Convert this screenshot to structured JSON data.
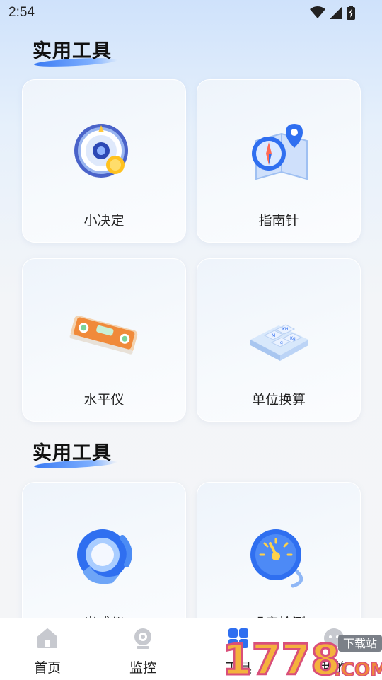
{
  "status_bar": {
    "time": "2:54"
  },
  "sections": [
    {
      "title": "实用工具"
    },
    {
      "title": "实用工具"
    }
  ],
  "tools": [
    {
      "label": "小决定",
      "icon": "decision-wheel-icon"
    },
    {
      "label": "指南针",
      "icon": "compass-map-icon"
    },
    {
      "label": "水平仪",
      "icon": "spirit-level-icon"
    },
    {
      "label": "单位换算",
      "icon": "unit-keys-icon"
    },
    {
      "label": "光感仪",
      "icon": "light-meter-icon"
    },
    {
      "label": "噪音检测",
      "icon": "noise-gauge-icon"
    }
  ],
  "nav": {
    "items": [
      {
        "label": "首页",
        "icon": "home-icon"
      },
      {
        "label": "监控",
        "icon": "camera-icon"
      },
      {
        "label": "工具",
        "icon": "tools-grid-icon",
        "active": true
      },
      {
        "label": "我的",
        "icon": "profile-icon"
      }
    ]
  },
  "watermark": {
    "text": "1778",
    "suffix": ".COM",
    "badge": "下载站"
  },
  "colors": {
    "accent": "#2f6ff0",
    "background_top": "#cfe2fb",
    "card": "#f7fafd"
  }
}
